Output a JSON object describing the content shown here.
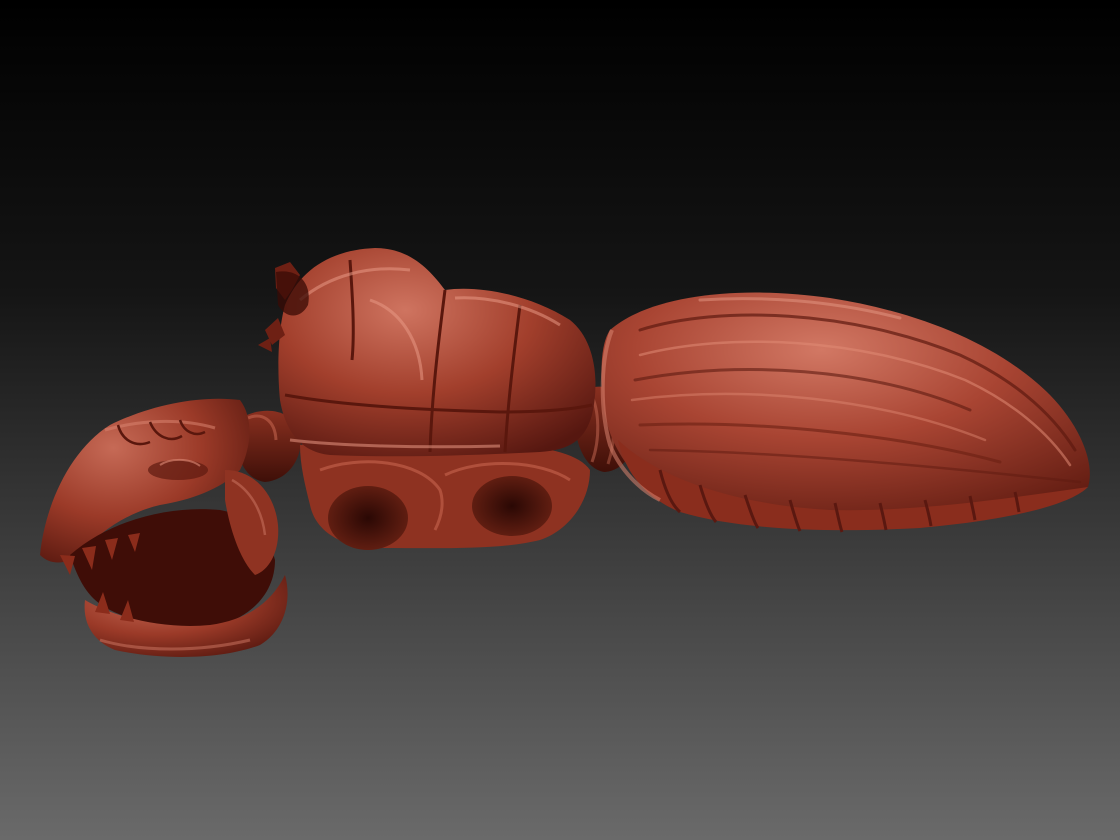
{
  "scene": {
    "subject": "sculpted-creature-model",
    "colors": {
      "background_top": "#000000",
      "background_bottom": "#6a6a6a",
      "clay_base": "#a2402b",
      "clay_highlight": "#d9806a",
      "clay_shadow": "#4a130b"
    }
  }
}
